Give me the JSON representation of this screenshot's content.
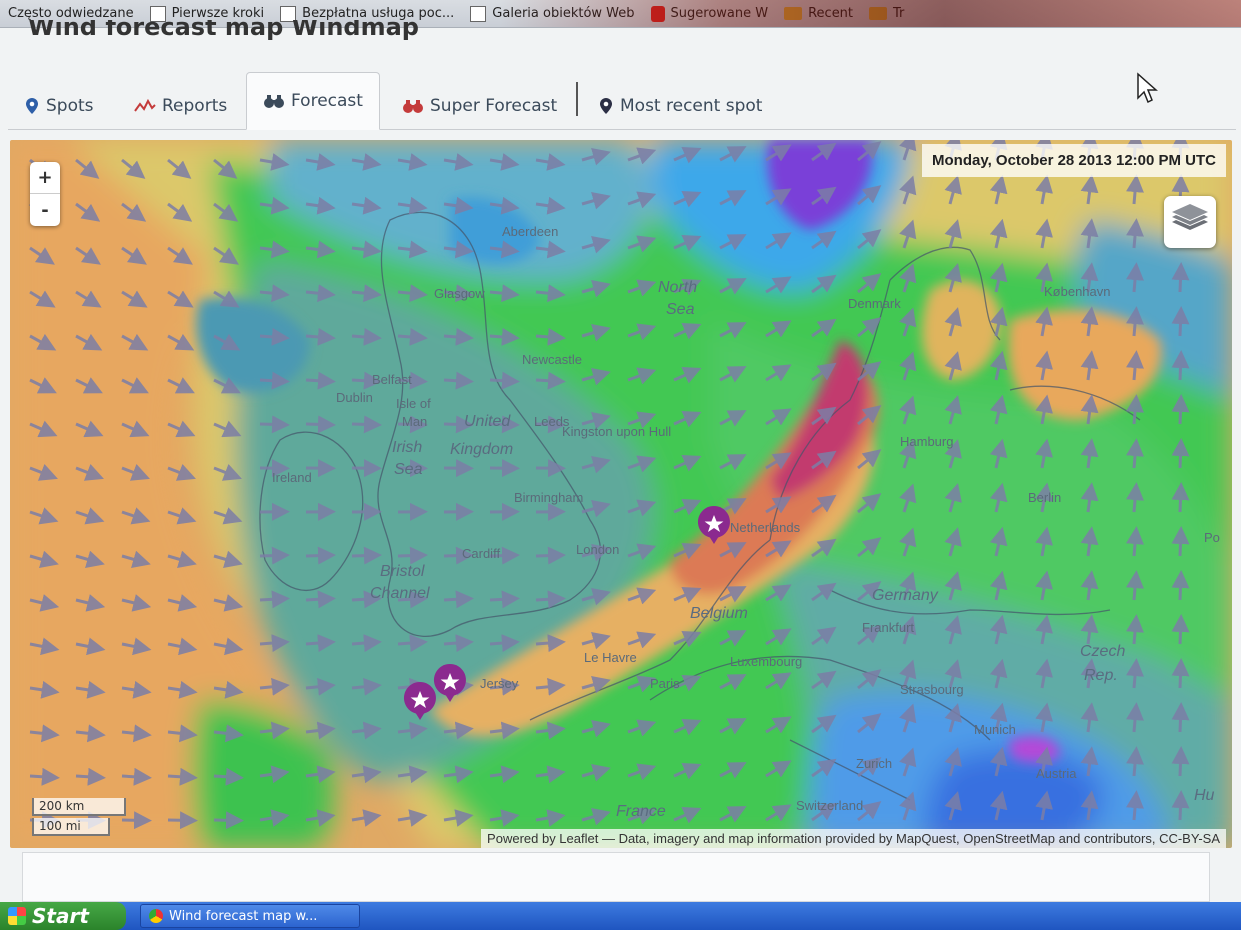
{
  "bookmarks": [
    {
      "label": "Często odwiedzane",
      "icon": "none"
    },
    {
      "label": "Pierwsze kroki",
      "icon": "page-icon"
    },
    {
      "label": "Bezpłatna usługa poc...",
      "icon": "page-icon"
    },
    {
      "label": "Galeria obiektów Web",
      "icon": "page-icon"
    },
    {
      "label": "Sugerowane W",
      "icon": "pin-icon"
    },
    {
      "label": "Recent",
      "icon": "folder-icon"
    },
    {
      "label": "Tr",
      "icon": "folder-icon"
    }
  ],
  "page": {
    "title": "Wind forecast map Windmap"
  },
  "tabs": [
    {
      "label": "Spots",
      "icon": "location-pin-icon",
      "active": false
    },
    {
      "label": "Reports",
      "icon": "chart-line-icon",
      "active": false
    },
    {
      "label": "Forecast",
      "icon": "binoculars-icon",
      "active": true
    },
    {
      "label": "Super Forecast",
      "icon": "binoculars-red-icon",
      "active": false
    },
    {
      "label": "Most recent spot",
      "icon": "location-pin-dark-icon",
      "active": false
    }
  ],
  "map": {
    "datetime": "Monday, October 28 2013 12:00 PM UTC",
    "zoom_in": "+",
    "zoom_out": "-",
    "scale_km": "200 km",
    "scale_mi": "100 mi",
    "attribution": "Powered by Leaflet — Data, imagery and map information provided by MapQuest, OpenStreetMap and contributors, CC-BY-SA",
    "labels": {
      "north_sea_1": "North",
      "north_sea_2": "Sea",
      "denmark": "Denmark",
      "ireland": "Ireland",
      "irish_sea_1": "Irish",
      "irish_sea_2": "Sea",
      "united_kingdom_1": "United",
      "united_kingdom_2": "Kingdom",
      "isle_of_man_1": "Isle of",
      "isle_of_man_2": "Man",
      "bristol_1": "Bristol",
      "bristol_2": "Channel",
      "london": "London",
      "birmingham": "Birmingham",
      "hamburg": "Hamburg",
      "berlin": "Berlin",
      "germany": "Germany",
      "netherlands": "Netherlands",
      "belgium": "Belgium",
      "frankfurt": "Frankfurt",
      "luxembourg": "Luxembourg",
      "paris": "Paris",
      "france": "France",
      "czech_1": "Czech",
      "czech_2": "Rep.",
      "munich": "Munich",
      "zurich": "Zurich",
      "switzerland": "Switzerland",
      "austria": "Austria",
      "kobenhavn": "København",
      "aberdeen": "Aberdeen",
      "glasgow": "Glasgow",
      "newcastle": "Newcastle",
      "leeds": "Leeds",
      "hull": "Kingston upon Hull",
      "cardiff": "Cardiff",
      "dublin": "Dublin",
      "belfast": "Belfast",
      "le_havre": "Le Havre",
      "strasbourg": "Strasbourg",
      "po": "Po",
      "hu": "Hu",
      "jersey": "Jersey"
    },
    "colors": {
      "orange": "#e8a85c",
      "yellow": "#dfc86a",
      "green": "#35d04a",
      "teal": "#5aa9a0",
      "blue": "#4fb0e6",
      "purple": "#7a3fd8",
      "magenta": "#c23a6e",
      "arrow": "#7c7ea6",
      "marker": "#8b2a8f"
    }
  },
  "taskbar": {
    "start": "Start",
    "window": "Wind forecast map w..."
  }
}
